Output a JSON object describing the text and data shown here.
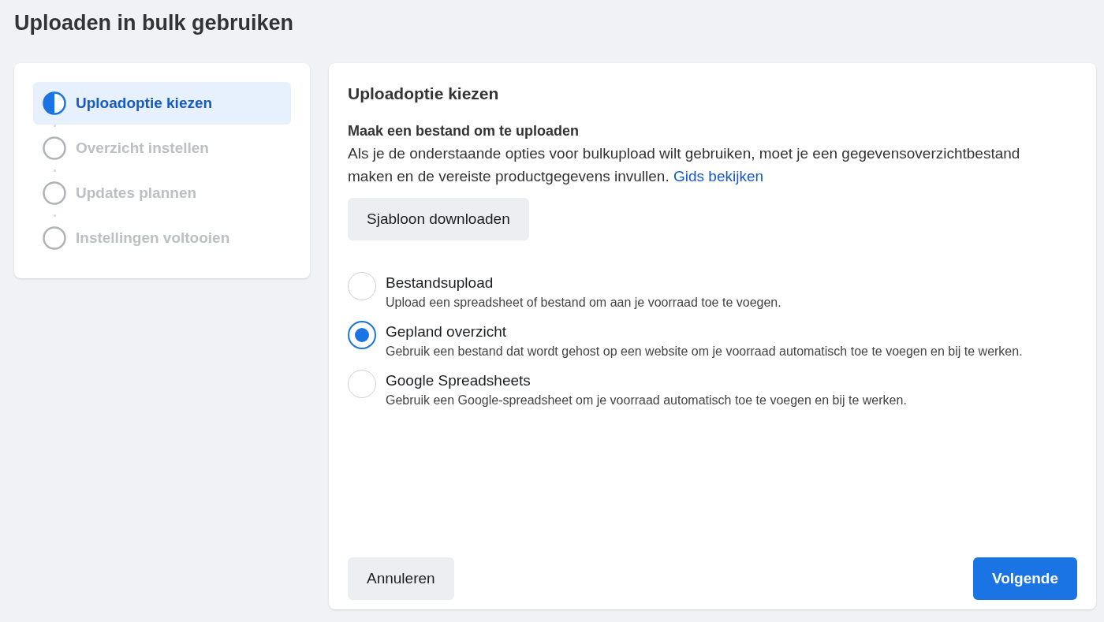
{
  "page_title": "Uploaden in bulk gebruiken",
  "steps": [
    {
      "label": "Uploadoptie kiezen",
      "selected": true
    },
    {
      "label": "Overzicht instellen",
      "selected": false
    },
    {
      "label": "Updates plannen",
      "selected": false
    },
    {
      "label": "Instellingen voltooien",
      "selected": false
    }
  ],
  "panel": {
    "title": "Uploadoptie kiezen",
    "section_title": "Maak een bestand om te uploaden",
    "description": "Als je de onderstaande opties voor bulkupload wilt gebruiken, moet je een gegevensoverzichtbestand maken en de vereiste productgegevens invullen.",
    "guide_link": "Gids bekijken",
    "template_button": "Sjabloon downloaden",
    "options": [
      {
        "label": "Bestandsupload",
        "description": "Upload een spreadsheet of bestand om aan je voorraad toe te voegen.",
        "selected": false
      },
      {
        "label": "Gepland overzicht",
        "description": "Gebruik een bestand dat wordt gehost op een website om je voorraad automatisch toe te voegen en bij te werken.",
        "selected": true
      },
      {
        "label": "Google Spreadsheets",
        "description": "Gebruik een Google-spreadsheet om je voorraad automatisch toe te voegen en bij te werken.",
        "selected": false
      }
    ],
    "cancel_button": "Annuleren",
    "next_button": "Volgende"
  }
}
